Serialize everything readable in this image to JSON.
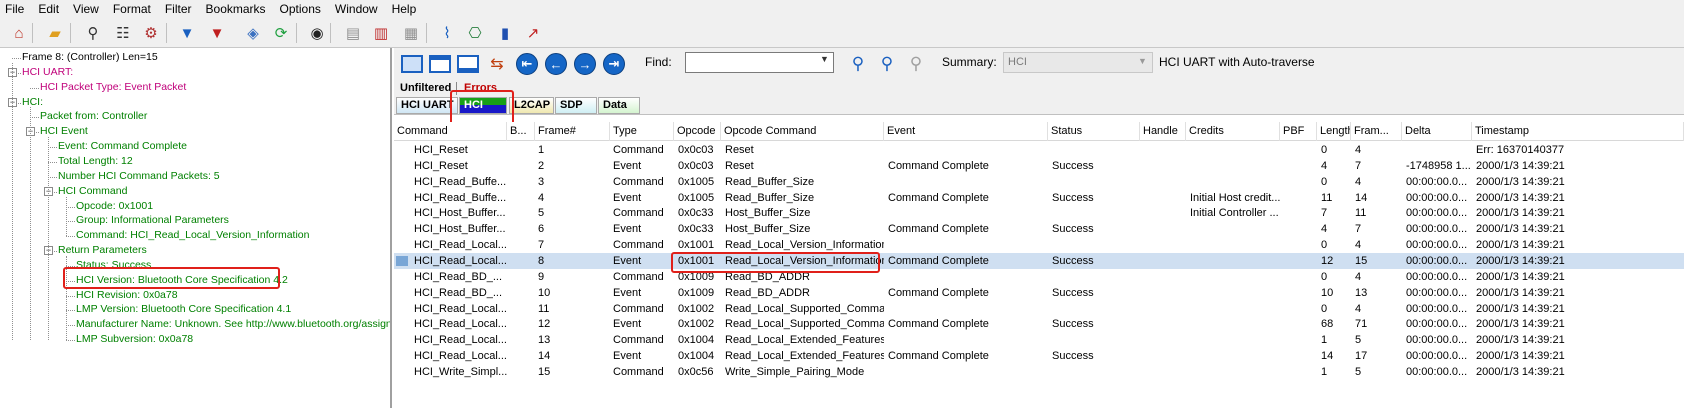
{
  "menu": [
    "File",
    "Edit",
    "View",
    "Format",
    "Filter",
    "Bookmarks",
    "Options",
    "Window",
    "Help"
  ],
  "toolbar_icons": [
    {
      "name": "home-icon",
      "glyph": "⌂",
      "color": "#c0392b"
    },
    {
      "name": "open-folder-icon",
      "glyph": "▰",
      "color": "#e0a020"
    },
    {
      "name": "find-icon",
      "glyph": "⚲",
      "color": "#333333"
    },
    {
      "name": "columns-icon",
      "glyph": "☷",
      "color": "#333333"
    },
    {
      "name": "settings-icon",
      "glyph": "⚙",
      "color": "#b03030"
    },
    {
      "name": "filter-icon",
      "glyph": "▼",
      "color": "#1a60c0"
    },
    {
      "name": "filter-red-icon",
      "glyph": "▼",
      "color": "#c02020"
    },
    {
      "name": "layers-icon",
      "glyph": "◈",
      "color": "#3a70c0"
    },
    {
      "name": "refresh-icon",
      "glyph": "⟳",
      "color": "#20a040"
    },
    {
      "name": "binoculars-icon",
      "glyph": "◉",
      "color": "#222222"
    },
    {
      "name": "note-icon",
      "glyph": "▤",
      "color": "#909090"
    },
    {
      "name": "book-icon",
      "glyph": "▥",
      "color": "#c03030"
    },
    {
      "name": "book-open-icon",
      "glyph": "▦",
      "color": "#909090"
    },
    {
      "name": "chart-icon",
      "glyph": "⌇",
      "color": "#1a60c0"
    },
    {
      "name": "network-icon",
      "glyph": "⎔",
      "color": "#2a8040"
    },
    {
      "name": "bar-chart-icon",
      "glyph": "▮",
      "color": "#2050b0"
    },
    {
      "name": "line-chart-icon",
      "glyph": "↗",
      "color": "#c02020"
    }
  ],
  "tree": [
    {
      "label": "Frame 8: (Controller) Len=15",
      "color": "#000000"
    },
    {
      "label": "HCI UART:",
      "color": "#c0007a"
    },
    {
      "label": "HCI Packet Type: Event Packet",
      "color": "#c0007a"
    },
    {
      "label": "HCI:",
      "color": "#008000"
    },
    {
      "label": "Packet from: Controller",
      "color": "#008000"
    },
    {
      "label": "HCI Event",
      "color": "#008000"
    },
    {
      "label": "Event: Command Complete",
      "color": "#008000"
    },
    {
      "label": "Total Length: 12",
      "color": "#008000"
    },
    {
      "label": "Number HCI Command Packets: 5",
      "color": "#008000"
    },
    {
      "label": "HCI Command",
      "color": "#008000"
    },
    {
      "label": "Opcode: 0x1001",
      "color": "#008000"
    },
    {
      "label": "Group: Informational Parameters",
      "color": "#008000"
    },
    {
      "label": "Command: HCI_Read_Local_Version_Information",
      "color": "#008000"
    },
    {
      "label": "Return Parameters",
      "color": "#008000"
    },
    {
      "label": "Status: Success",
      "color": "#008000"
    },
    {
      "label": "HCI Version: Bluetooth Core Specification 4.2",
      "color": "#008000"
    },
    {
      "label": "HCI Revision: 0x0a78",
      "color": "#008000"
    },
    {
      "label": "LMP Version: Bluetooth Core Specification 4.1",
      "color": "#008000"
    },
    {
      "label": "Manufacturer Name: Unknown. See http://www.bluetooth.org/assigne",
      "color": "#008000"
    },
    {
      "label": "LMP Subversion: 0x0a78",
      "color": "#008000"
    }
  ],
  "find": {
    "label": "Find:",
    "value": ""
  },
  "summary": {
    "label": "Summary:",
    "value": "HCI",
    "auto": "HCI UART with Auto-traverse"
  },
  "filter_tabs": [
    {
      "label": "Unfiltered",
      "color": "#000000"
    },
    {
      "label": "Errors",
      "color": "#c00000"
    }
  ],
  "proto_tabs": [
    {
      "label": "HCI UART",
      "color": "#000000"
    },
    {
      "label": "HCI",
      "color": "#ffffff"
    },
    {
      "label": "L2CAP",
      "color": "#000000"
    },
    {
      "label": "SDP",
      "color": "#000000"
    },
    {
      "label": "Data",
      "color": "#000000"
    }
  ],
  "columns": [
    "Command",
    "B...",
    "Frame#",
    "Type",
    "Opcode",
    "Opcode Command",
    "Event",
    "Status",
    "Handle",
    "Credits",
    "PBF",
    "Length",
    "Fram...",
    "Delta",
    "Timestamp"
  ],
  "rows": [
    [
      "HCI_Reset",
      "",
      "1",
      "Command",
      "0x0c03",
      "Reset",
      "",
      "",
      "",
      "",
      "",
      "0",
      "4",
      "",
      "Err: 16370140377"
    ],
    [
      "HCI_Reset",
      "",
      "2",
      "Event",
      "0x0c03",
      "Reset",
      "Command Complete",
      "Success",
      "",
      "",
      "",
      "4",
      "7",
      "-1748958 1...",
      "2000/1/3 14:39:21"
    ],
    [
      "HCI_Read_Buffe...",
      "",
      "3",
      "Command",
      "0x1005",
      "Read_Buffer_Size",
      "",
      "",
      "",
      "",
      "",
      "0",
      "4",
      "00:00:00.0...",
      "2000/1/3 14:39:21"
    ],
    [
      "HCI_Read_Buffe...",
      "",
      "4",
      "Event",
      "0x1005",
      "Read_Buffer_Size",
      "Command Complete",
      "Success",
      "",
      "Initial Host credit...",
      "",
      "11",
      "14",
      "00:00:00.0...",
      "2000/1/3 14:39:21"
    ],
    [
      "HCI_Host_Buffer...",
      "",
      "5",
      "Command",
      "0x0c33",
      "Host_Buffer_Size",
      "",
      "",
      "",
      "Initial Controller ...",
      "",
      "7",
      "11",
      "00:00:00.0...",
      "2000/1/3 14:39:21"
    ],
    [
      "HCI_Host_Buffer...",
      "",
      "6",
      "Event",
      "0x0c33",
      "Host_Buffer_Size",
      "Command Complete",
      "Success",
      "",
      "",
      "",
      "4",
      "7",
      "00:00:00.0...",
      "2000/1/3 14:39:21"
    ],
    [
      "HCI_Read_Local...",
      "",
      "7",
      "Command",
      "0x1001",
      "Read_Local_Version_Information",
      "",
      "",
      "",
      "",
      "",
      "0",
      "4",
      "00:00:00.0...",
      "2000/1/3 14:39:21"
    ],
    [
      "HCI_Read_Local...",
      "",
      "8",
      "Event",
      "0x1001",
      "Read_Local_Version_Information",
      "Command Complete",
      "Success",
      "",
      "",
      "",
      "12",
      "15",
      "00:00:00.0...",
      "2000/1/3 14:39:21"
    ],
    [
      "HCI_Read_BD_...",
      "",
      "9",
      "Command",
      "0x1009",
      "Read_BD_ADDR",
      "",
      "",
      "",
      "",
      "",
      "0",
      "4",
      "00:00:00.0...",
      "2000/1/3 14:39:21"
    ],
    [
      "HCI_Read_BD_...",
      "",
      "10",
      "Event",
      "0x1009",
      "Read_BD_ADDR",
      "Command Complete",
      "Success",
      "",
      "",
      "",
      "10",
      "13",
      "00:00:00.0...",
      "2000/1/3 14:39:21"
    ],
    [
      "HCI_Read_Local...",
      "",
      "11",
      "Command",
      "0x1002",
      "Read_Local_Supported_Comma...",
      "",
      "",
      "",
      "",
      "",
      "0",
      "4",
      "00:00:00.0...",
      "2000/1/3 14:39:21"
    ],
    [
      "HCI_Read_Local...",
      "",
      "12",
      "Event",
      "0x1002",
      "Read_Local_Supported_Comma...",
      "Command Complete",
      "Success",
      "",
      "",
      "",
      "68",
      "71",
      "00:00:00.0...",
      "2000/1/3 14:39:21"
    ],
    [
      "HCI_Read_Local...",
      "",
      "13",
      "Command",
      "0x1004",
      "Read_Local_Extended_Features",
      "",
      "",
      "",
      "",
      "",
      "1",
      "5",
      "00:00:00.0...",
      "2000/1/3 14:39:21"
    ],
    [
      "HCI_Read_Local...",
      "",
      "14",
      "Event",
      "0x1004",
      "Read_Local_Extended_Features",
      "Command Complete",
      "Success",
      "",
      "",
      "",
      "14",
      "17",
      "00:00:00.0...",
      "2000/1/3 14:39:21"
    ],
    [
      "HCI_Write_Simpl...",
      "",
      "15",
      "Command",
      "0x0c56",
      "Write_Simple_Pairing_Mode",
      "",
      "",
      "",
      "",
      "",
      "1",
      "5",
      "00:00:00.0...",
      "2000/1/3 14:39:21"
    ]
  ],
  "selected_row": 7,
  "colors": {
    "highlight": "#e0201a",
    "selection": "#cfdff1",
    "hci_tab_top": "#18a018",
    "hci_tab_bottom": "#1818c8"
  }
}
